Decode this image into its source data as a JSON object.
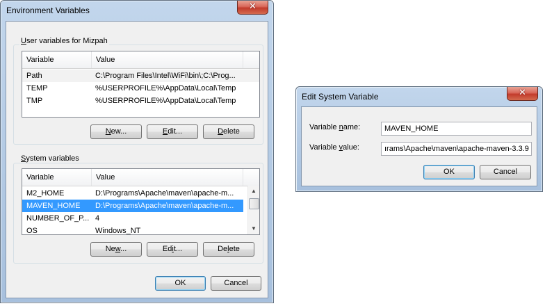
{
  "env_window": {
    "title": "Environment Variables",
    "user_group": {
      "label_pre": "",
      "label_key": "U",
      "label_post": "ser variables for Mizpah",
      "col_variable": "Variable",
      "col_value": "Value",
      "rows": [
        {
          "variable": "Path",
          "value": "C:\\Program Files\\Intel\\WiFi\\bin\\;C:\\Prog..."
        },
        {
          "variable": "TEMP",
          "value": "%USERPROFILE%\\AppData\\Local\\Temp"
        },
        {
          "variable": "TMP",
          "value": "%USERPROFILE%\\AppData\\Local\\Temp"
        }
      ],
      "new_pre": "",
      "new_key": "N",
      "new_post": "ew...",
      "edit_pre": "",
      "edit_key": "E",
      "edit_post": "dit...",
      "delete_pre": "",
      "delete_key": "D",
      "delete_post": "elete"
    },
    "system_group": {
      "label_pre": "",
      "label_key": "S",
      "label_post": "ystem variables",
      "col_variable": "Variable",
      "col_value": "Value",
      "rows": [
        {
          "variable": "M2_HOME",
          "value": "D:\\Programs\\Apache\\maven\\apache-m..."
        },
        {
          "variable": "MAVEN_HOME",
          "value": "D:\\Programs\\Apache\\maven\\apache-m..."
        },
        {
          "variable": "NUMBER_OF_P...",
          "value": "4"
        },
        {
          "variable": "OS",
          "value": "Windows_NT"
        }
      ],
      "new_pre": "Ne",
      "new_key": "w",
      "new_post": "...",
      "edit_pre": "Ed",
      "edit_key": "i",
      "edit_post": "t...",
      "delete_pre": "De",
      "delete_key": "l",
      "delete_post": "ete"
    },
    "ok_label": "OK",
    "cancel_label": "Cancel"
  },
  "edit_window": {
    "title": "Edit System Variable",
    "name_label_pre": "Variable ",
    "name_label_key": "n",
    "name_label_post": "ame:",
    "name_value": "MAVEN_HOME",
    "value_label_pre": "Variable ",
    "value_label_key": "v",
    "value_label_post": "alue:",
    "value_value": "ırams\\Apache\\maven\\apache-maven-3.3.9",
    "ok_label": "OK",
    "cancel_label": "Cancel"
  },
  "close_glyph": "✕",
  "icons": {
    "close": "close-icon",
    "scroll_up": "chevron-up-icon",
    "scroll_down": "chevron-down-icon"
  },
  "colors": {
    "selection": "#3399ff",
    "close_button": "#c23b2c",
    "title_bar": "#b4cbe6"
  }
}
